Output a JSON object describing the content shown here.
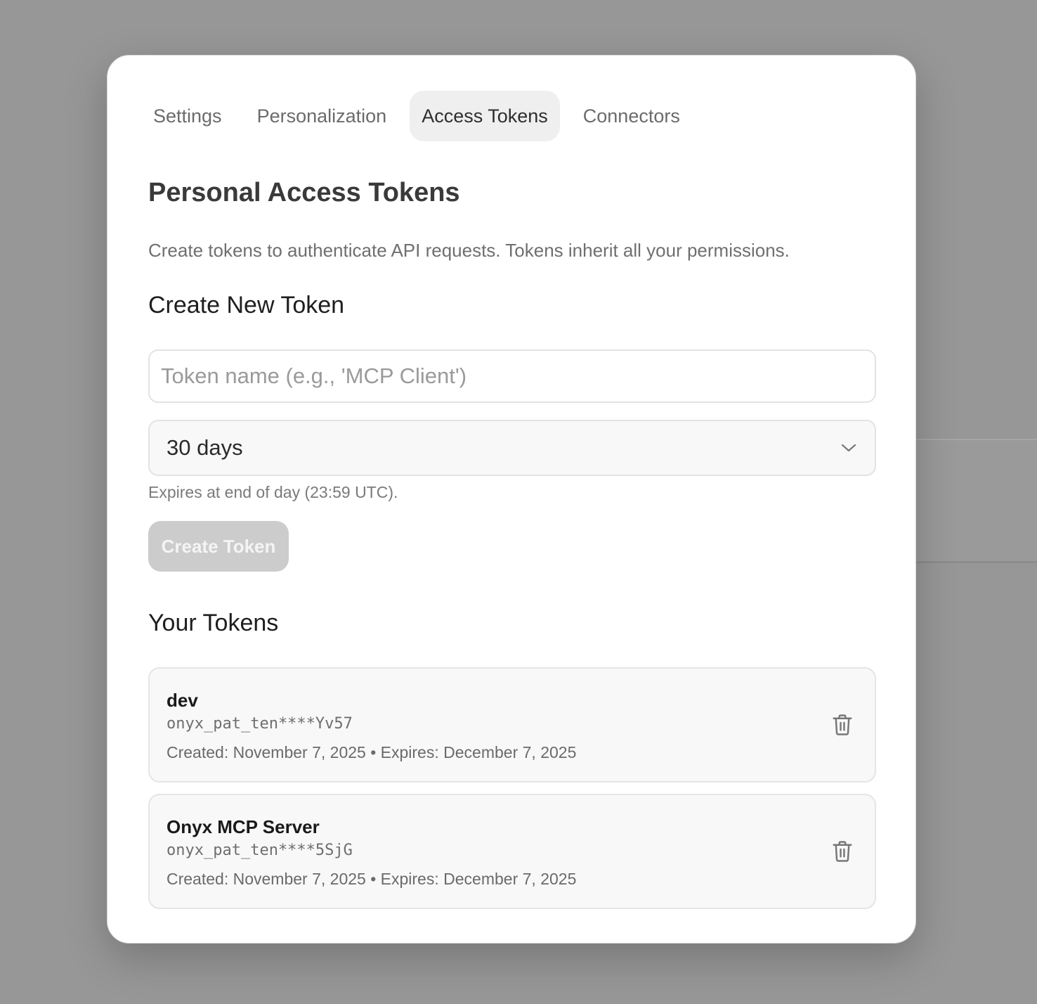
{
  "tabs": [
    {
      "label": "Settings",
      "active": false
    },
    {
      "label": "Personalization",
      "active": false
    },
    {
      "label": "Access Tokens",
      "active": true
    },
    {
      "label": "Connectors",
      "active": false
    }
  ],
  "page": {
    "title": "Personal Access Tokens",
    "description": "Create tokens to authenticate API requests. Tokens inherit all your permissions."
  },
  "create": {
    "title": "Create New Token",
    "name_placeholder": "Token name (e.g., 'MCP Client')",
    "name_value": "",
    "expiry_selected": "30 days",
    "expiry_note": "Expires at end of day (23:59 UTC).",
    "button_label": "Create Token",
    "button_disabled": true
  },
  "tokens_section": {
    "title": "Your Tokens",
    "items": [
      {
        "name": "dev",
        "masked_key": "onyx_pat_ten****Yv57",
        "meta": "Created: November 7, 2025 • Expires: December 7, 2025",
        "delete_icon": "trash-icon"
      },
      {
        "name": "Onyx MCP Server",
        "masked_key": "onyx_pat_ten****5SjG",
        "meta": "Created: November 7, 2025 • Expires: December 7, 2025",
        "delete_icon": "trash-icon"
      }
    ]
  },
  "icons": {
    "select_chevron": "chevron-down-icon"
  },
  "colors": {
    "overlay": "#979797",
    "active_tab_bg": "#efefef",
    "disabled_button_bg": "#cccccc",
    "card_bg": "#f8f8f8"
  }
}
